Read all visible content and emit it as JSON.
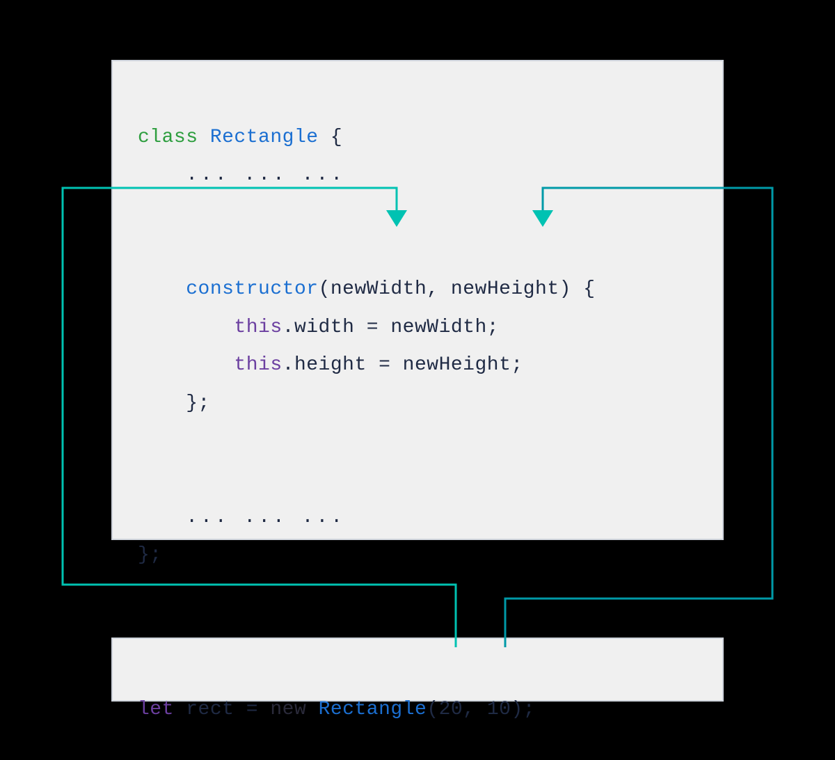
{
  "colors": {
    "arrow1": "#00c2b2",
    "arrow2": "#009aa8",
    "background": "#000000",
    "codeBackground": "#f0f0f0",
    "codeBorder": "#cfd4dc"
  },
  "classBlock": {
    "kwClass": "class",
    "className": "Rectangle",
    "openBrace": " {",
    "ellipsisTop": "... ... ...",
    "constructorKw": "constructor",
    "paramOpen": "(",
    "param1": "newWidth",
    "paramSep": ", ",
    "param2": "newHeight",
    "paramClose": ") {",
    "bodyLine1_this": "this",
    "bodyLine1_rest": ".width = newWidth;",
    "bodyLine2_this": "this",
    "bodyLine2_rest": ".height = newHeight;",
    "ctorClose": "};",
    "ellipsisBottom": "... ... ...",
    "classClose": "};"
  },
  "usageBlock": {
    "letKw": "let",
    "varName": " rect = ",
    "newKw": "new",
    "space": " ",
    "typeName": "Rectangle",
    "callOpen": "(",
    "arg1": "20",
    "argSep": ", ",
    "arg2": "10",
    "callClose": ");"
  }
}
